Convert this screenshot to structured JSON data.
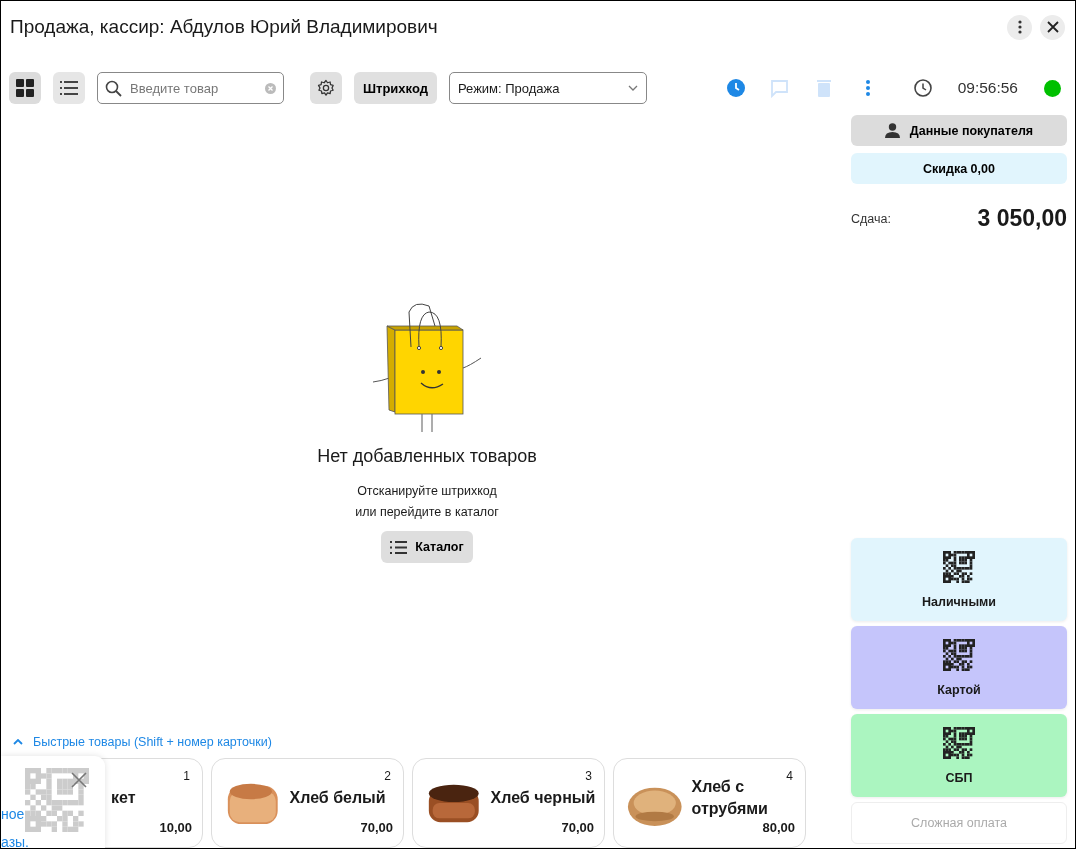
{
  "window": {
    "title": "Продажа, кассир: Абдулов Юрий Владимирович"
  },
  "toolbar": {
    "view_buttons": [
      {
        "kind": "grid",
        "selected": true
      },
      {
        "kind": "list",
        "selected": false
      }
    ],
    "search": {
      "placeholder": "Введите товар"
    },
    "barcode_button": "Штрихкод",
    "mode": {
      "value": "Режим: Продажа"
    },
    "actions": [
      {
        "kind": "history",
        "disabled": false
      },
      {
        "kind": "comment",
        "disabled": true
      },
      {
        "kind": "delete",
        "disabled": true
      },
      {
        "kind": "more",
        "disabled": false
      }
    ],
    "time": "09:56:56",
    "status": {
      "color": "#00c000"
    }
  },
  "empty_state": {
    "title": "Нет добавленных товаров",
    "hint_lines": [
      "Отсканируйте штрихкод",
      "или перейдите в каталог"
    ],
    "catalog_button": "Каталог"
  },
  "quick_goods": {
    "header": "Быстрые товары (Shift + номер карточки)",
    "expanded": true,
    "cards": [
      {
        "number": "1",
        "name": "кет",
        "price": "10,00"
      },
      {
        "number": "2",
        "name": "Хлеб белый",
        "price": "70,00"
      },
      {
        "number": "3",
        "name": "Хлеб черный",
        "price": "70,00"
      },
      {
        "number": "4",
        "name": "Хлеб с отрубями",
        "price": "80,00"
      }
    ]
  },
  "qr_popup": {
    "text_lines": [
      "ное",
      "азы."
    ]
  },
  "side": {
    "customer_button": "Данные покупателя",
    "discount_button": "Скидка 0,00",
    "change_label": "Сдача:",
    "change_value": "3 050,00",
    "payments": [
      {
        "label": "Наличными",
        "color": "#e1f5fd",
        "disabled": false
      },
      {
        "label": "Картой",
        "color": "#c5c5fb",
        "disabled": false
      },
      {
        "label": "СБП",
        "color": "#abf5c0",
        "disabled": false
      },
      {
        "label": "Сложная оплата",
        "color": "#ffffff",
        "disabled": true
      }
    ]
  }
}
